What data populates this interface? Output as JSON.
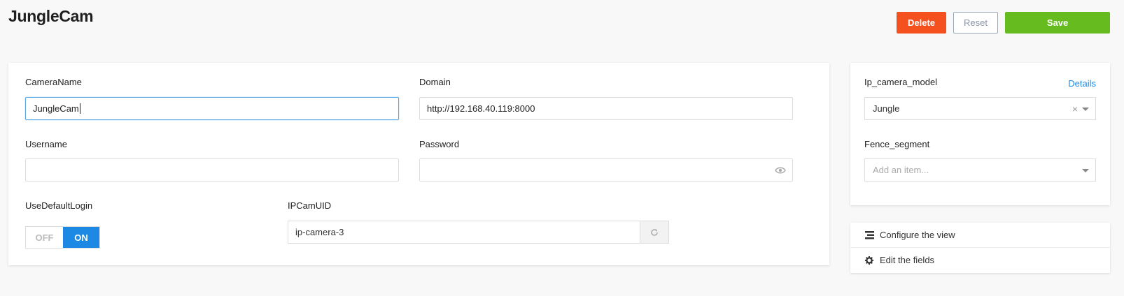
{
  "page": {
    "title": "JungleCam"
  },
  "toolbar": {
    "delete_label": "Delete",
    "reset_label": "Reset",
    "save_label": "Save"
  },
  "form": {
    "camera_name": {
      "label": "CameraName",
      "value": "JungleCam"
    },
    "domain": {
      "label": "Domain",
      "value": "http://192.168.40.119:8000"
    },
    "username": {
      "label": "Username",
      "value": ""
    },
    "password": {
      "label": "Password",
      "value": ""
    },
    "use_default_login": {
      "label": "UseDefaultLogin",
      "off_label": "OFF",
      "on_label": "ON",
      "state": "on"
    },
    "ipcam_uid": {
      "label": "IPCamUID",
      "value": "ip-camera-3"
    }
  },
  "side": {
    "ip_camera_model": {
      "label": "Ip_camera_model",
      "details_label": "Details",
      "value": "Jungle"
    },
    "fence_segment": {
      "label": "Fence_segment",
      "placeholder": "Add an item..."
    }
  },
  "actions": [
    {
      "label": "Configure the view",
      "icon": "configure-view-icon"
    },
    {
      "label": "Edit the fields",
      "icon": "gear-icon"
    }
  ],
  "colors": {
    "delete": "#f4511e",
    "save": "#66bb1f",
    "accent": "#1e88e5"
  }
}
